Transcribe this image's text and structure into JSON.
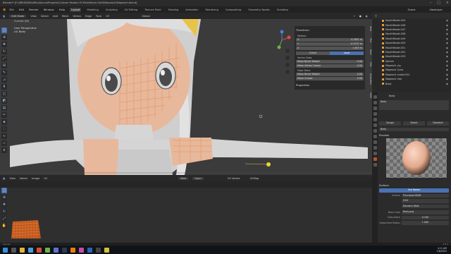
{
  "titlebar": {
    "title": "Blender* [F:\\ARKID\\MikuMikuDance\\Projects\\Custom Models Of Mine\\Mario Stuff\\Mapeach\\Mapeach.blend]",
    "scene_label": "Scene",
    "view_layer_label": "ViewLayer"
  },
  "menubar": {
    "items": [
      "File",
      "Edit",
      "Render",
      "Window",
      "Help"
    ],
    "workspaces": [
      "Layout",
      "Modeling",
      "Sculpting",
      "UV Editing",
      "Texture Paint",
      "Shading",
      "Animation",
      "Rendering",
      "Compositing",
      "Geometry Nodes",
      "Scripting"
    ]
  },
  "viewport_header": {
    "mode": "Edit Mode",
    "items": [
      "View",
      "Select",
      "Add",
      "Mesh",
      "Vertex",
      "Edge",
      "Face",
      "UV"
    ],
    "orientation": "Global"
  },
  "viewport": {
    "view_name": "User Perspective",
    "object_name": "(0) Body",
    "transform_toggle": "Current (Vt)"
  },
  "npanel": {
    "title": "Transform",
    "median_label": "Median:",
    "x": "0.2841 m",
    "y": "-0.5707 m",
    "z": "1.653 m",
    "global_label": "Global",
    "local_label": "Local",
    "vertex_data_label": "Vertex Data:",
    "mean_bevel_weight": "Mean Bevel Weight",
    "mean_bevel_weight_val": "0.00",
    "mean_vertex_crease": "Mean Vertex Crease",
    "mean_vertex_crease_val": "0.00",
    "edge_data_label": "Edge Data:",
    "mean_edge_bevel": "Mean Bevel Weight",
    "mean_edge_bevel_val": "0.00",
    "mean_crease": "Mean Crease",
    "mean_crease_val": "0.00",
    "properties_label": "Properties",
    "side_tabs": [
      "Item",
      "Tool",
      "View",
      "Edit",
      "Animation",
      "MMD"
    ]
  },
  "uv_header": {
    "mode": "UV Editor",
    "items": [
      "View",
      "Select",
      "Image",
      "UV"
    ],
    "uv_vertex": "UV Vertex",
    "uv_map": "UVMap",
    "new_label": "New",
    "open_label": "Open"
  },
  "outliner": {
    "rows": [
      "MouthModel.045",
      "MouthModel.046",
      "MouthModel.047",
      "MouthModel.048",
      "MouthModel.049",
      "MouthModel.050",
      "MouthModel.051",
      "MouthModel.052",
      "MouthModel.053",
      "Sphere",
      "Mapeach_rig",
      "Mapeach Lines",
      "Mapeach model.001",
      "Mapeach Hair",
      "Body"
    ]
  },
  "properties": {
    "object_name": "Body",
    "material_name": "Body",
    "tabs_row": [
      "Assign",
      "Select",
      "Deselect"
    ],
    "preview_label": "Preview",
    "surface_label": "Surface",
    "surface_value": "Use Nodes",
    "surface_field": "Principled BSDF",
    "ggx": "GGX",
    "random_walk": "Random Walk",
    "base_color_label": "Base Color",
    "base_color_value": "Body.png",
    "subsurface_label": "Subsurface",
    "subsurface_value": "0.100",
    "subsurface_radius_label": "Subsurface Radius",
    "subsurface_radius_value": "1.000"
  },
  "status": {
    "left": "Cancel",
    "right": "3.3.1"
  },
  "taskbar": {
    "time": "4:11 AM",
    "date": "1/6/2024"
  },
  "colors": {
    "accent": "#4a72b0",
    "skin": "#e8b89c",
    "mesh": "#d9d9d9"
  }
}
